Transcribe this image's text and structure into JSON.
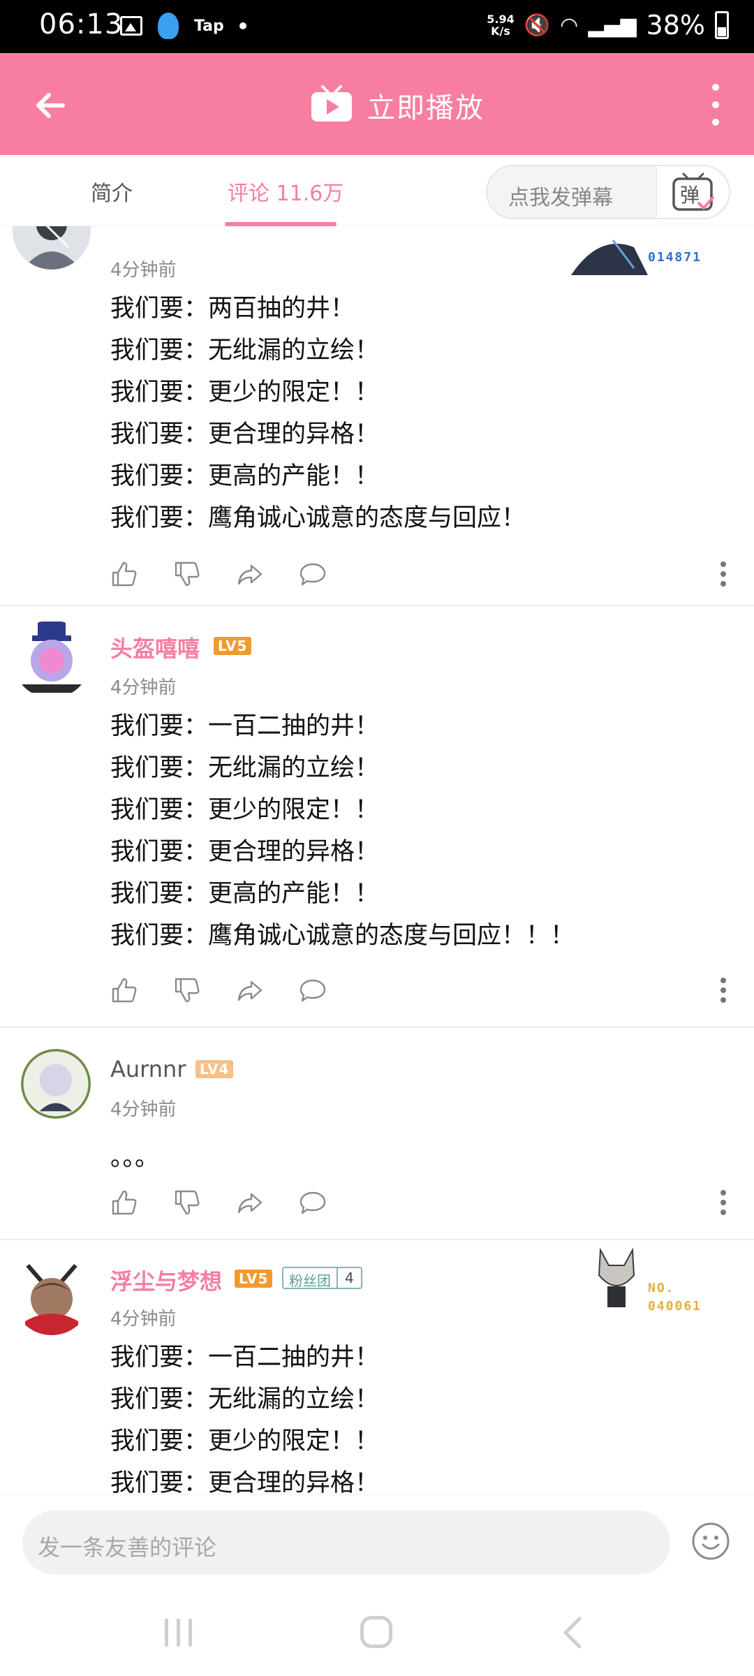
{
  "status_bar": {
    "time": "06:13",
    "app_label": "Tap",
    "net_speed_top": "5.94",
    "net_speed_bottom": "K/s",
    "battery_pct": "38%"
  },
  "header": {
    "title": "立即播放",
    "accent_color": "#f77ea0"
  },
  "tabs": {
    "intro": "简介",
    "comments": "评论 11.6万",
    "danmaku_placeholder": "点我发弹幕",
    "danmaku_button_label": "弹"
  },
  "comments": [
    {
      "username": "",
      "time": "4分钟前",
      "badge_number": "014871",
      "lines": [
        "我们要：两百抽的井！",
        "我们要：无纰漏的立绘！",
        "我们要：更少的限定！！",
        "我们要：更合理的异格！",
        "我们要：更高的产能！！",
        "我们要：鹰角诚心诚意的态度与回应！"
      ]
    },
    {
      "username": "头盔嘻嘻",
      "level": "LV5",
      "time": "4分钟前",
      "lines": [
        "我们要：一百二抽的井！",
        "我们要：无纰漏的立绘！",
        "我们要：更少的限定！！",
        "我们要：更合理的异格！",
        "我们要：更高的产能！！",
        "我们要：鹰角诚心诚意的态度与回应！！！"
      ]
    },
    {
      "username": "Aurnnr",
      "level": "LV4",
      "time": "4分钟前",
      "lines": [
        "。。。"
      ]
    },
    {
      "username": "浮尘与梦想",
      "level": "LV5",
      "fan_badge_name": "粉丝团",
      "fan_badge_level": "4",
      "badge_prefix": "NO.",
      "badge_number": "040061",
      "time": "4分钟前",
      "lines": [
        "我们要：一百二抽的井！",
        "我们要：无纰漏的立绘！",
        "我们要：更少的限定！！",
        "我们要：更合理的异格！"
      ]
    }
  ],
  "composer": {
    "placeholder": "发一条友善的评论"
  }
}
